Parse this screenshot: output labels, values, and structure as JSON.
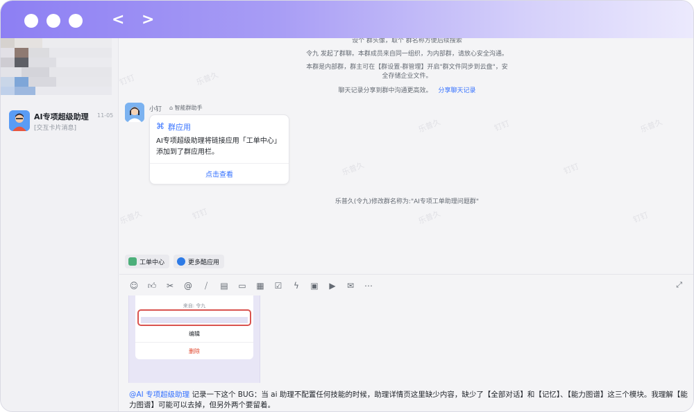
{
  "window": {
    "dots": [
      "",
      "",
      ""
    ],
    "nav": {
      "back": "<",
      "forward": ">"
    }
  },
  "sidebar": {
    "conversation": {
      "title": "AI专项超级助理",
      "subtitle": "[交互卡片消息]",
      "time": "11-05"
    }
  },
  "chat": {
    "system_messages": {
      "top_partial": "设个 群头像，取个 群名称方便后续搜索",
      "created": "令九 发起了群聊。本群成员来自同一组织，为内部群，请放心安全沟通。",
      "internal_line1": "本群是内部群，群主可在【群设置-群管理】开启\"群文件同步到云盘\"，安",
      "internal_line2": "全存储企业文件。",
      "share_text": "聊天记录分享到群中沟通更高效。",
      "share_link": "分享聊天记录",
      "rename": "乐普久(令九)修改群名称为:\"AI专项工单助理问题群\""
    },
    "bot": {
      "name": "小钉",
      "badge": "智能群助手"
    },
    "card": {
      "icon": "⌘",
      "title": "群应用",
      "body": "AI专项超级助理将链接应用「工单中心」添加到了群应用栏。",
      "action": "点击查看"
    },
    "watermarks": [
      "乐普久",
      "钉钉"
    ],
    "app_bar": [
      {
        "label": "工单中心",
        "icon": "cube-icon"
      },
      {
        "label": "更多酷应用",
        "icon": "apps-icon"
      }
    ]
  },
  "composer": {
    "toolbar": [
      "emoji-icon",
      "thumbs-up-icon",
      "scissors-icon",
      "at-icon",
      "slash-icon",
      "doc-icon",
      "folder-icon",
      "calendar-icon",
      "checkbox-icon",
      "lightning-icon",
      "live-icon",
      "video-icon",
      "mail-icon",
      "more-icon"
    ],
    "screenshot": {
      "from": "来自: 令九",
      "edit": "编辑",
      "delete": "删除"
    },
    "mention": "@AI 专项超级助理",
    "text": " 记录一下这个 BUG：当 ai 助理不配置任何技能的时候，助理详情页这里缺少内容，缺少了【全部对话】和【记忆】、【能力图谱】这三个模块。我理解【能力图谱】可能可以去掉，但另外两个要留着。"
  },
  "colors": {
    "accent": "#3370ff",
    "titlebar_start": "#8d7ff3",
    "titlebar_end": "#eceafd",
    "highlight": "#d9534f",
    "delete": "#e0442a"
  }
}
